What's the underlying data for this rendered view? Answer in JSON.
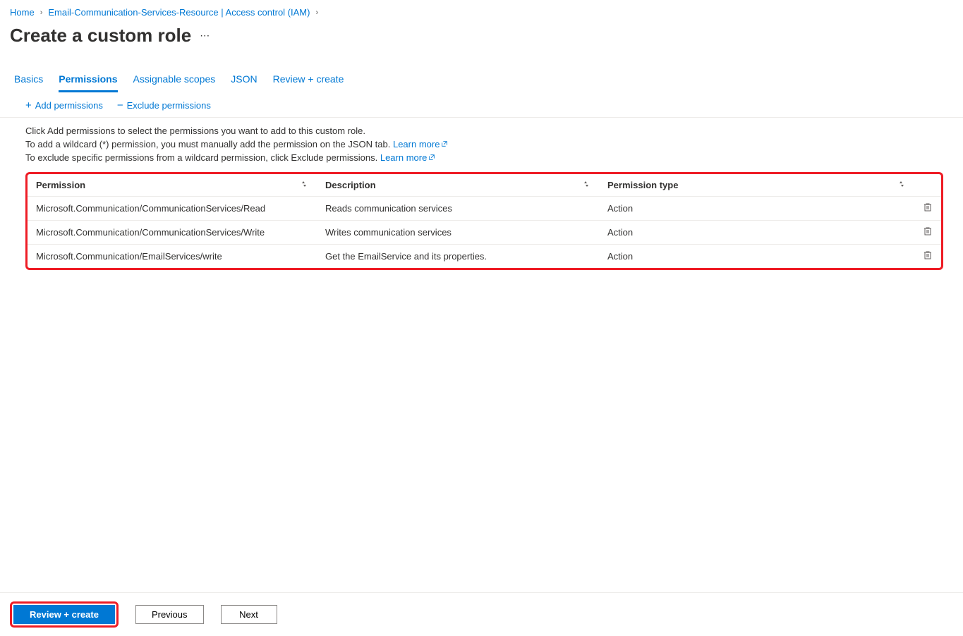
{
  "breadcrumb": {
    "items": [
      {
        "label": "Home"
      },
      {
        "label": "Email-Communication-Services-Resource | Access control (IAM)"
      }
    ]
  },
  "page": {
    "title": "Create a custom role"
  },
  "tabs": [
    {
      "label": "Basics",
      "active": false
    },
    {
      "label": "Permissions",
      "active": true
    },
    {
      "label": "Assignable scopes",
      "active": false
    },
    {
      "label": "JSON",
      "active": false
    },
    {
      "label": "Review + create",
      "active": false
    }
  ],
  "toolbar": {
    "add": "Add permissions",
    "exclude": "Exclude permissions"
  },
  "help": {
    "line1": "Click Add permissions to select the permissions you want to add to this custom role.",
    "line2a": "To add a wildcard (*) permission, you must manually add the permission on the JSON tab. ",
    "line3a": "To exclude specific permissions from a wildcard permission, click Exclude permissions. ",
    "learn_more": "Learn more"
  },
  "table": {
    "headers": {
      "permission": "Permission",
      "description": "Description",
      "type": "Permission type"
    },
    "rows": [
      {
        "permission": "Microsoft.Communication/CommunicationServices/Read",
        "description": "Reads communication services",
        "type": "Action"
      },
      {
        "permission": "Microsoft.Communication/CommunicationServices/Write",
        "description": "Writes communication services",
        "type": "Action"
      },
      {
        "permission": "Microsoft.Communication/EmailServices/write",
        "description": "Get the EmailService and its properties.",
        "type": "Action"
      }
    ]
  },
  "footer": {
    "review_create": "Review + create",
    "previous": "Previous",
    "next": "Next"
  }
}
